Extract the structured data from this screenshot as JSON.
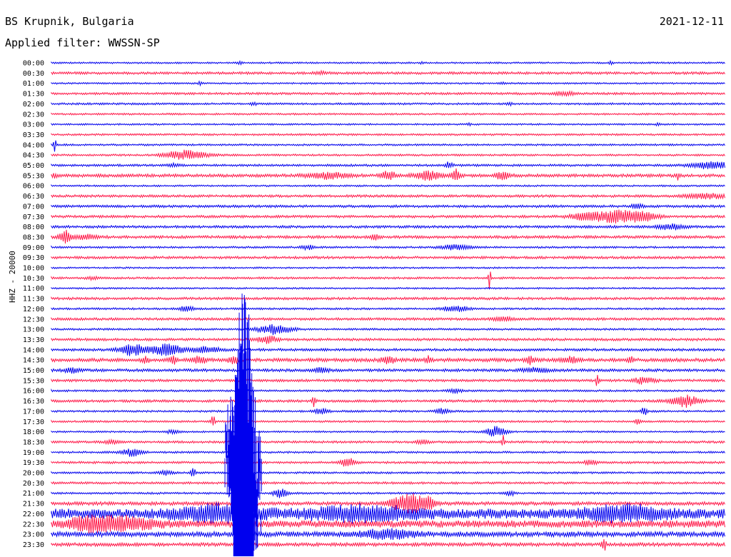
{
  "header": {
    "station": "BS Krupnik, Bulgaria",
    "date": "2021-12-11",
    "filter": "Applied filter: WWSSN-SP",
    "channel": "HHZ - 20000"
  },
  "colors": {
    "trace_a": "#0000ee",
    "trace_b": "#ff1a4a",
    "background": "#ffffff",
    "text": "#000000"
  },
  "chart_data": {
    "type": "line",
    "chart_kind": "helicorder",
    "row_duration_minutes": 30,
    "grid": false,
    "legend": "none",
    "rows": [
      {
        "time": "00:00",
        "amplitude": 1.2,
        "events": [
          {
            "pos": 0.28,
            "amp": 2.5,
            "width": 0.003
          },
          {
            "pos": 0.55,
            "amp": 2,
            "width": 0.003
          },
          {
            "pos": 0.83,
            "amp": 2,
            "width": 0.003
          }
        ]
      },
      {
        "time": "00:30",
        "amplitude": 1.8,
        "events": [
          {
            "pos": 0.4,
            "amp": 1.5,
            "width": 0.01
          }
        ]
      },
      {
        "time": "01:00",
        "amplitude": 1.2,
        "events": [
          {
            "pos": 0.22,
            "amp": 3,
            "width": 0.003
          },
          {
            "pos": 0.67,
            "amp": 2,
            "width": 0.004
          }
        ]
      },
      {
        "time": "01:30",
        "amplitude": 1.6,
        "events": [
          {
            "pos": 0.76,
            "amp": 3,
            "width": 0.015
          }
        ]
      },
      {
        "time": "02:00",
        "amplitude": 1.4,
        "events": [
          {
            "pos": 0.3,
            "amp": 2,
            "width": 0.005
          },
          {
            "pos": 0.68,
            "amp": 2,
            "width": 0.004
          }
        ]
      },
      {
        "time": "02:30",
        "amplitude": 1.3,
        "events": []
      },
      {
        "time": "03:00",
        "amplitude": 1.2,
        "events": [
          {
            "pos": 0.62,
            "amp": 2.2,
            "width": 0.003
          },
          {
            "pos": 0.9,
            "amp": 2,
            "width": 0.003
          }
        ]
      },
      {
        "time": "03:30",
        "amplitude": 1.4,
        "events": []
      },
      {
        "time": "04:00",
        "amplitude": 1.3,
        "events": [
          {
            "pos": 0.005,
            "amp": 10,
            "width": 0.002
          }
        ]
      },
      {
        "time": "04:30",
        "amplitude": 1.4,
        "events": [
          {
            "pos": 0.2,
            "amp": 7,
            "width": 0.03
          }
        ]
      },
      {
        "time": "05:00",
        "amplitude": 1.6,
        "events": [
          {
            "pos": 0.18,
            "amp": 2.5,
            "width": 0.008
          },
          {
            "pos": 0.59,
            "amp": 5,
            "width": 0.005
          },
          {
            "pos": 0.98,
            "amp": 5,
            "width": 0.03
          }
        ]
      },
      {
        "time": "05:30",
        "amplitude": 2.2,
        "events": [
          {
            "pos": 0.005,
            "amp": 3,
            "width": 0.004
          },
          {
            "pos": 0.41,
            "amp": 4,
            "width": 0.03
          },
          {
            "pos": 0.5,
            "amp": 7,
            "width": 0.01
          },
          {
            "pos": 0.56,
            "amp": 6,
            "width": 0.02
          },
          {
            "pos": 0.6,
            "amp": 8,
            "width": 0.006
          },
          {
            "pos": 0.67,
            "amp": 6,
            "width": 0.01
          },
          {
            "pos": 0.93,
            "amp": 6,
            "width": 0.002
          }
        ]
      },
      {
        "time": "06:00",
        "amplitude": 1.2,
        "events": []
      },
      {
        "time": "06:30",
        "amplitude": 1.8,
        "events": [
          {
            "pos": 0.97,
            "amp": 4,
            "width": 0.03
          }
        ]
      },
      {
        "time": "07:00",
        "amplitude": 1.8,
        "events": [
          {
            "pos": 0.87,
            "amp": 3,
            "width": 0.01
          }
        ]
      },
      {
        "time": "07:30",
        "amplitude": 1.8,
        "events": [
          {
            "pos": 0.84,
            "amp": 9,
            "width": 0.04
          },
          {
            "pos": 0.79,
            "amp": 4,
            "width": 0.02
          },
          {
            "pos": 0.88,
            "amp": 4,
            "width": 0.02
          }
        ]
      },
      {
        "time": "08:00",
        "amplitude": 1.8,
        "events": [
          {
            "pos": 0.92,
            "amp": 4,
            "width": 0.02
          }
        ]
      },
      {
        "time": "08:30",
        "amplitude": 2,
        "events": [
          {
            "pos": 0.02,
            "amp": 9,
            "width": 0.008
          },
          {
            "pos": 0.05,
            "amp": 3,
            "width": 0.02
          },
          {
            "pos": 0.48,
            "amp": 4,
            "width": 0.006
          }
        ]
      },
      {
        "time": "09:00",
        "amplitude": 1.4,
        "events": [
          {
            "pos": 0.38,
            "amp": 3,
            "width": 0.01
          },
          {
            "pos": 0.6,
            "amp": 4,
            "width": 0.02
          }
        ]
      },
      {
        "time": "09:30",
        "amplitude": 1.8,
        "events": []
      },
      {
        "time": "10:00",
        "amplitude": 1.2,
        "events": []
      },
      {
        "time": "10:30",
        "amplitude": 1.5,
        "events": [
          {
            "pos": 0.65,
            "amp": 22,
            "width": 0.0015
          },
          {
            "pos": 0.06,
            "amp": 2,
            "width": 0.008
          }
        ]
      },
      {
        "time": "11:00",
        "amplitude": 1.2,
        "events": []
      },
      {
        "time": "11:30",
        "amplitude": 1.8,
        "events": []
      },
      {
        "time": "12:00",
        "amplitude": 1.4,
        "events": [
          {
            "pos": 0.2,
            "amp": 4,
            "width": 0.01
          },
          {
            "pos": 0.6,
            "amp": 4,
            "width": 0.02
          }
        ]
      },
      {
        "time": "12:30",
        "amplitude": 1.8,
        "events": [
          {
            "pos": 0.67,
            "amp": 3,
            "width": 0.015
          }
        ]
      },
      {
        "time": "13:00",
        "amplitude": 1.4,
        "events": [
          {
            "pos": 0.33,
            "amp": 7,
            "width": 0.025
          }
        ]
      },
      {
        "time": "13:30",
        "amplitude": 1.8,
        "events": [
          {
            "pos": 0.32,
            "amp": 5,
            "width": 0.015
          }
        ]
      },
      {
        "time": "14:00",
        "amplitude": 1.8,
        "events": [
          {
            "pos": 0.12,
            "amp": 8,
            "width": 0.02
          },
          {
            "pos": 0.17,
            "amp": 8,
            "width": 0.025
          },
          {
            "pos": 0.23,
            "amp": 4,
            "width": 0.02
          }
        ]
      },
      {
        "time": "14:30",
        "amplitude": 2.5,
        "events": [
          {
            "pos": 0.14,
            "amp": 5,
            "width": 0.005
          },
          {
            "pos": 0.18,
            "amp": 7,
            "width": 0.005
          },
          {
            "pos": 0.22,
            "amp": 5,
            "width": 0.01
          },
          {
            "pos": 0.27,
            "amp": 4,
            "width": 0.01
          },
          {
            "pos": 0.5,
            "amp": 5,
            "width": 0.01
          },
          {
            "pos": 0.56,
            "amp": 6,
            "width": 0.004
          },
          {
            "pos": 0.71,
            "amp": 6,
            "width": 0.006
          },
          {
            "pos": 0.77,
            "amp": 5,
            "width": 0.01
          },
          {
            "pos": 0.86,
            "amp": 6,
            "width": 0.004
          }
        ]
      },
      {
        "time": "15:00",
        "amplitude": 2,
        "events": [
          {
            "pos": 0.03,
            "amp": 4,
            "width": 0.01
          },
          {
            "pos": 0.4,
            "amp": 4,
            "width": 0.01
          },
          {
            "pos": 0.72,
            "amp": 3,
            "width": 0.02
          }
        ]
      },
      {
        "time": "15:30",
        "amplitude": 1.8,
        "events": [
          {
            "pos": 0.81,
            "amp": 10,
            "width": 0.002
          },
          {
            "pos": 0.88,
            "amp": 5,
            "width": 0.015
          }
        ]
      },
      {
        "time": "16:00",
        "amplitude": 1.4,
        "events": [
          {
            "pos": 0.6,
            "amp": 3,
            "width": 0.01
          }
        ]
      },
      {
        "time": "16:30",
        "amplitude": 1.8,
        "events": [
          {
            "pos": 0.39,
            "amp": 8,
            "width": 0.003
          },
          {
            "pos": 0.94,
            "amp": 8,
            "width": 0.02
          }
        ]
      },
      {
        "time": "17:00",
        "amplitude": 1.4,
        "events": [
          {
            "pos": 0.4,
            "amp": 4,
            "width": 0.01
          },
          {
            "pos": 0.58,
            "amp": 4,
            "width": 0.01
          },
          {
            "pos": 0.88,
            "amp": 8,
            "width": 0.004
          }
        ]
      },
      {
        "time": "17:30",
        "amplitude": 1.4,
        "events": [
          {
            "pos": 0.24,
            "amp": 8,
            "width": 0.003
          },
          {
            "pos": 0.87,
            "amp": 4,
            "width": 0.004
          }
        ]
      },
      {
        "time": "18:00",
        "amplitude": 1.2,
        "events": [
          {
            "pos": 0.66,
            "amp": 7,
            "width": 0.015
          },
          {
            "pos": 0.18,
            "amp": 3,
            "width": 0.01
          }
        ]
      },
      {
        "time": "18:30",
        "amplitude": 1.6,
        "events": [
          {
            "pos": 0.67,
            "amp": 10,
            "width": 0.002
          },
          {
            "pos": 0.55,
            "amp": 3,
            "width": 0.01
          },
          {
            "pos": 0.09,
            "amp": 3,
            "width": 0.01
          }
        ]
      },
      {
        "time": "19:00",
        "amplitude": 1.4,
        "events": [
          {
            "pos": 0.12,
            "amp": 6,
            "width": 0.015
          }
        ]
      },
      {
        "time": "19:30",
        "amplitude": 1.6,
        "events": [
          {
            "pos": 0.44,
            "amp": 6,
            "width": 0.01
          },
          {
            "pos": 0.8,
            "amp": 3,
            "width": 0.01
          }
        ]
      },
      {
        "time": "20:00",
        "amplitude": 1.4,
        "events": [
          {
            "pos": 0.21,
            "amp": 10,
            "width": 0.003
          },
          {
            "pos": 0.17,
            "amp": 3,
            "width": 0.01
          }
        ]
      },
      {
        "time": "20:30",
        "amplitude": 1.6,
        "events": []
      },
      {
        "time": "21:00",
        "amplitude": 1.4,
        "events": [
          {
            "pos": 0.34,
            "amp": 6,
            "width": 0.01
          },
          {
            "pos": 0.68,
            "amp": 4,
            "width": 0.006
          }
        ]
      },
      {
        "time": "21:30",
        "amplitude": 2.5,
        "events": [
          {
            "pos": 0.53,
            "amp": 14,
            "width": 0.025
          },
          {
            "pos": 0.56,
            "amp": 8,
            "width": 0.008
          }
        ]
      },
      {
        "time": "22:00",
        "amplitude": 7,
        "events": [
          {
            "pos": 0.25,
            "amp": 10,
            "width": 0.06
          },
          {
            "pos": 0.46,
            "amp": 8,
            "width": 0.08
          },
          {
            "pos": 0.85,
            "amp": 9,
            "width": 0.06
          }
        ]
      },
      {
        "time": "22:30",
        "amplitude": 5,
        "events": [
          {
            "pos": 0.1,
            "amp": 9,
            "width": 0.05
          },
          {
            "pos": 0.05,
            "amp": 6,
            "width": 0.03
          }
        ]
      },
      {
        "time": "23:00",
        "amplitude": 3.5,
        "events": [
          {
            "pos": 0.5,
            "amp": 6,
            "width": 0.04
          }
        ]
      },
      {
        "time": "23:30",
        "amplitude": 2.5,
        "events": [
          {
            "pos": 0.82,
            "amp": 10,
            "width": 0.003
          }
        ]
      }
    ],
    "big_event": {
      "pos": 0.285,
      "width": 0.055,
      "start_row": "11:00",
      "end_row": "23:30",
      "color": "#0000ee"
    }
  }
}
